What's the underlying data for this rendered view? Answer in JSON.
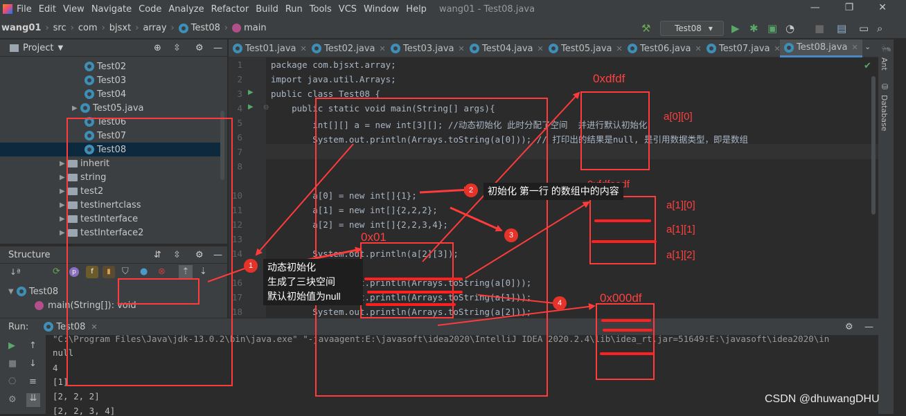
{
  "menu": {
    "items": [
      "File",
      "Edit",
      "View",
      "Navigate",
      "Code",
      "Analyze",
      "Refactor",
      "Build",
      "Run",
      "Tools",
      "VCS",
      "Window",
      "Help"
    ],
    "window_title": "wang01 - Test08.java"
  },
  "nav": {
    "project": "wang01",
    "crumbs": [
      "src",
      "com",
      "bjsxt",
      "array",
      "Test08",
      "main"
    ],
    "run_config": "Test08"
  },
  "project_panel": {
    "title": "Project",
    "items": [
      "Test02",
      "Test03",
      "Test04",
      "Test05.java",
      "Test06",
      "Test07",
      "Test08",
      "inherit",
      "string",
      "test2",
      "testinertclass",
      "testInterface",
      "testInterface2"
    ]
  },
  "structure_panel": {
    "title": "Structure",
    "class_name": "Test08",
    "method": "main(String[]): void"
  },
  "tabs": [
    "Test01.java",
    "Test02.java",
    "Test03.java",
    "Test04.java",
    "Test05.java",
    "Test06.java",
    "Test07.java",
    "Test08.java"
  ],
  "line_numbers": [
    "1",
    "2",
    "3",
    "4",
    "5",
    "6",
    "7",
    "8",
    "",
    "10",
    "11",
    "12",
    "13",
    "14",
    "",
    "16",
    "17",
    "18"
  ],
  "code": {
    "l1": "package com.bjsxt.array;",
    "l2": "import java.util.Arrays;",
    "l3": "public class Test08 {",
    "l4": "    public static void main(String[] args){",
    "l5": "        int[][] a = new int[3][]; //动态初始化 此时分配了空间  并进行默认初始化",
    "l6": "        System.out.println(Arrays.toString(a[0])); // 打印出的结果是null, 是引用数据类型，即是数组",
    "l10": "        a[0] = new int[]{1};",
    "l11": "        a[1] = new int[]{2,2,2};",
    "l12": "        a[2] = new int[]{2,2,3,4};",
    "l14": "        System.out.println(a[2][3]);",
    "l16": "        System.out.println(Arrays.toString(a[0]));",
    "l17": "        System.out.println(Arrays.toString(a[1]));",
    "l18": "        System.out.println(Arrays.toString(a[2]));"
  },
  "run_panel": {
    "title": "Run:",
    "config": "Test08"
  },
  "console": [
    "\"C:\\Program Files\\Java\\jdk-13.0.2\\bin\\java.exe\" \"-javaagent:E:\\javasoft\\idea2020\\IntelliJ IDEA 2020.2.4\\lib\\idea_rt.jar=51649:E:\\javasoft\\idea2020\\in",
    "null",
    "4",
    "[1]",
    "[2, 2, 2]",
    "[2, 2, 3, 4]"
  ],
  "right_tools": [
    "Ant",
    "Database"
  ],
  "annotations": {
    "addr_top": "0xdfdf",
    "addr_mid": "0xfdfasdf",
    "addr_stack": "0x01",
    "addr_bottom": "0x000df",
    "a00": "a[0][0]",
    "a10": "a[1][0]",
    "a11": "a[1][1]",
    "a12": "a[1][2]",
    "callout1_lines": [
      "动态初始化",
      "生成了三块空间",
      "默认初始值为null"
    ],
    "callout2": "初始化 第一行 的数组中的内容",
    "badges": [
      "1",
      "2",
      "3",
      "4"
    ],
    "red": "#ff3b3b"
  },
  "watermark": "CSDN @dhuwangDHU"
}
